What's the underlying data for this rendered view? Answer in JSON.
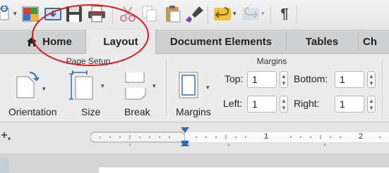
{
  "toolbar": {
    "icons": [
      "new-document-icon",
      "templates-icon",
      "download-icon",
      "save-icon",
      "print-icon",
      "cut-icon",
      "copy-icon",
      "paste-icon",
      "format-painter-icon",
      "undo-icon",
      "redo-icon",
      "pilcrow-icon"
    ],
    "pilcrow": "¶"
  },
  "tabs": [
    {
      "label": "Home"
    },
    {
      "label": "Layout"
    },
    {
      "label": "Document Elements"
    },
    {
      "label": "Tables"
    },
    {
      "label": "Ch"
    }
  ],
  "active_tab": "Layout",
  "ribbon": {
    "page_setup": {
      "title": "Page Setup",
      "orientation_label": "Orientation",
      "size_label": "Size",
      "break_label": "Break"
    },
    "margins": {
      "title": "Margins",
      "margins_button_label": "Margins",
      "top_label": "Top:",
      "top_value": "1",
      "left_label": "Left:",
      "left_value": "1",
      "bottom_label": "Bottom:",
      "bottom_value": "1",
      "right_label": "Right:",
      "right_value": "1"
    }
  },
  "ruler": {
    "mark_1": "1",
    "mark_2": "2"
  },
  "colors": {
    "highlight_circle": "#e0161b",
    "accent_blue": "#2f6db5"
  }
}
